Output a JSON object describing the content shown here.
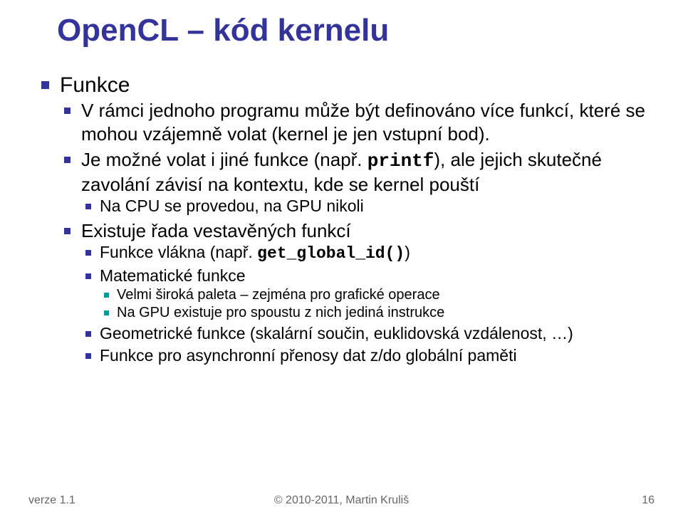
{
  "title": "OpenCL – kód kernelu",
  "lvl1": {
    "item0": "Funkce"
  },
  "lvl2": {
    "item0": "V rámci jednoho programu může být definováno více funkcí, které se mohou vzájemně volat (kernel je jen vstupní bod).",
    "item1_pre": "Je možné volat i jiné funkce (např. ",
    "item1_code": "printf",
    "item1_post": "), ale jejich skutečné zavolání závisí na kontextu, kde se kernel pouští",
    "item2": "Existuje řada vestavěných funkcí"
  },
  "lvl3": {
    "item0": "Na CPU se provedou, na GPU nikoli",
    "item1_pre": "Funkce vlákna (např. ",
    "item1_code": "get_global_id()",
    "item1_post": ")",
    "item2": "Matematické funkce",
    "item3": "Geometrické funkce (skalární součin, euklidovská vzdálenost, …)",
    "item4": "Funkce pro asynchronní přenosy dat z/do globální paměti"
  },
  "lvl4": {
    "item0": "Velmi široká paleta – zejména pro grafické operace",
    "item1": "Na GPU existuje pro spoustu z nich jediná instrukce"
  },
  "footer": {
    "left": "verze 1.1",
    "center": "© 2010-2011, Martin Kruliš",
    "right": "16"
  }
}
